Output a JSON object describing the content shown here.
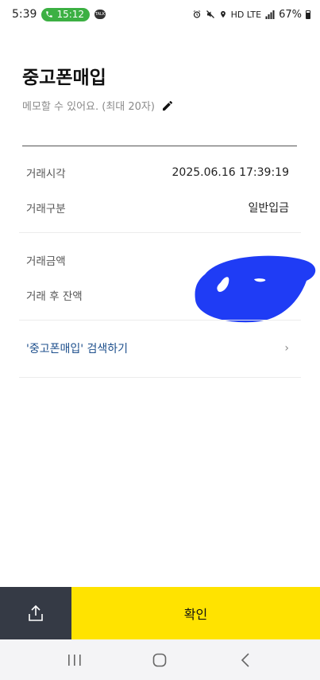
{
  "status_bar": {
    "time": "5:39",
    "call_duration": "15:12",
    "talk_badge": "TALK",
    "network": "HD LTE",
    "battery": "67%"
  },
  "header": {
    "title": "중고폰매입",
    "memo_placeholder": "메모할 수 있어요. (최대 20자)"
  },
  "details": {
    "datetime_label": "거래시각",
    "datetime_value": "2025.06.16 17:39:19",
    "type_label": "거래구분",
    "type_value": "일반입금",
    "amount_label": "거래금액",
    "balance_label": "거래 후 잔액"
  },
  "search_link": {
    "label": "'중고폰매입' 검색하기",
    "chevron": "›"
  },
  "actions": {
    "confirm_label": "확인"
  },
  "colors": {
    "accent_yellow": "#ffe300",
    "share_bg": "#353a45",
    "link_blue": "#1d4f8c",
    "redaction_blue": "#1f3cf5"
  }
}
